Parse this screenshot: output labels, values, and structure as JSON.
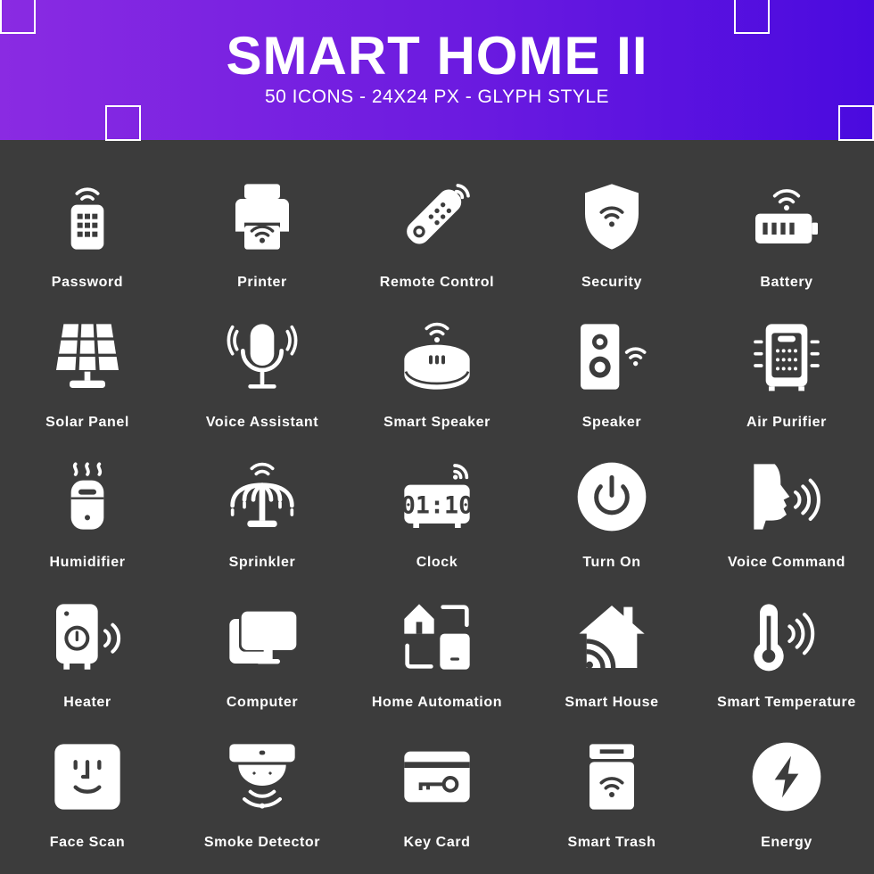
{
  "header": {
    "title": "SMART HOME II",
    "subtitle": "50 ICONS - 24X24 PX - GLYPH STYLE",
    "gradient_start": "#8a2be2",
    "gradient_end": "#4a0adf"
  },
  "background_color": "#3c3c3c",
  "icons": [
    {
      "label": "Password",
      "icon": "password-remote-icon"
    },
    {
      "label": "Printer",
      "icon": "printer-icon"
    },
    {
      "label": "Remote Control",
      "icon": "remote-control-icon"
    },
    {
      "label": "Security",
      "icon": "shield-wifi-icon"
    },
    {
      "label": "Battery",
      "icon": "battery-icon"
    },
    {
      "label": "Solar Panel",
      "icon": "solar-panel-icon"
    },
    {
      "label": "Voice Assistant",
      "icon": "microphone-icon"
    },
    {
      "label": "Smart Speaker",
      "icon": "smart-speaker-icon"
    },
    {
      "label": "Speaker",
      "icon": "speaker-icon"
    },
    {
      "label": "Air Purifier",
      "icon": "air-purifier-icon"
    },
    {
      "label": "Humidifier",
      "icon": "humidifier-icon"
    },
    {
      "label": "Sprinkler",
      "icon": "sprinkler-icon"
    },
    {
      "label": "Clock",
      "icon": "digital-clock-icon",
      "display": "01:10"
    },
    {
      "label": "Turn On",
      "icon": "power-icon"
    },
    {
      "label": "Voice Command",
      "icon": "voice-command-icon"
    },
    {
      "label": "Heater",
      "icon": "heater-icon"
    },
    {
      "label": "Computer",
      "icon": "computer-icon"
    },
    {
      "label": "Home Automation",
      "icon": "home-automation-icon"
    },
    {
      "label": "Smart House",
      "icon": "smart-house-icon"
    },
    {
      "label": "Smart Temperature",
      "icon": "thermometer-icon"
    },
    {
      "label": "Face Scan",
      "icon": "face-scan-icon"
    },
    {
      "label": "Smoke Detector",
      "icon": "smoke-detector-icon"
    },
    {
      "label": "Key Card",
      "icon": "key-card-icon"
    },
    {
      "label": "Smart Trash",
      "icon": "smart-trash-icon"
    },
    {
      "label": "Energy",
      "icon": "energy-bolt-icon"
    }
  ]
}
